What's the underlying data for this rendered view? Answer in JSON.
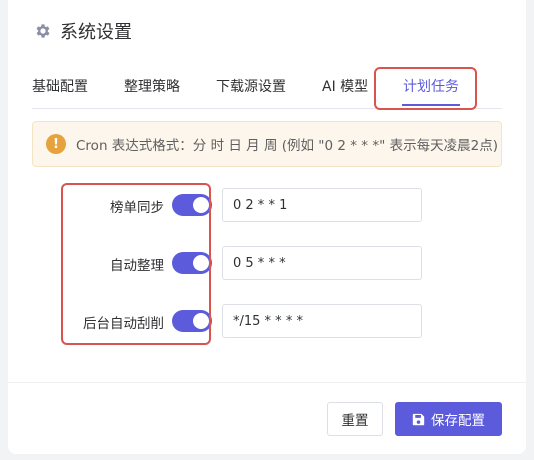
{
  "header": {
    "title": "系统设置",
    "icon": "gear-icon"
  },
  "tabs": [
    {
      "label": "基础配置",
      "active": false
    },
    {
      "label": "整理策略",
      "active": false
    },
    {
      "label": "下载源设置",
      "active": false
    },
    {
      "label": "AI 模型",
      "active": false
    },
    {
      "label": "计划任务",
      "active": true
    }
  ],
  "alert": {
    "icon": "warning-icon",
    "text": "Cron 表达式格式：分 时 日 月 周 (例如 \"0 2 * * *\" 表示每天凌晨2点)"
  },
  "schedules": [
    {
      "label": "榜单同步",
      "enabled": true,
      "cron": "0 2 * * 1"
    },
    {
      "label": "自动整理",
      "enabled": true,
      "cron": "0 5 * * *"
    },
    {
      "label": "后台自动刮削",
      "enabled": true,
      "cron": "*/15 * * * *"
    }
  ],
  "footer": {
    "reset_label": "重置",
    "save_label": "保存配置",
    "save_icon": "floppy-disk-icon"
  },
  "colors": {
    "accent": "#5b5bdc",
    "warning": "#e6a23c",
    "highlight": "#d9534f"
  }
}
